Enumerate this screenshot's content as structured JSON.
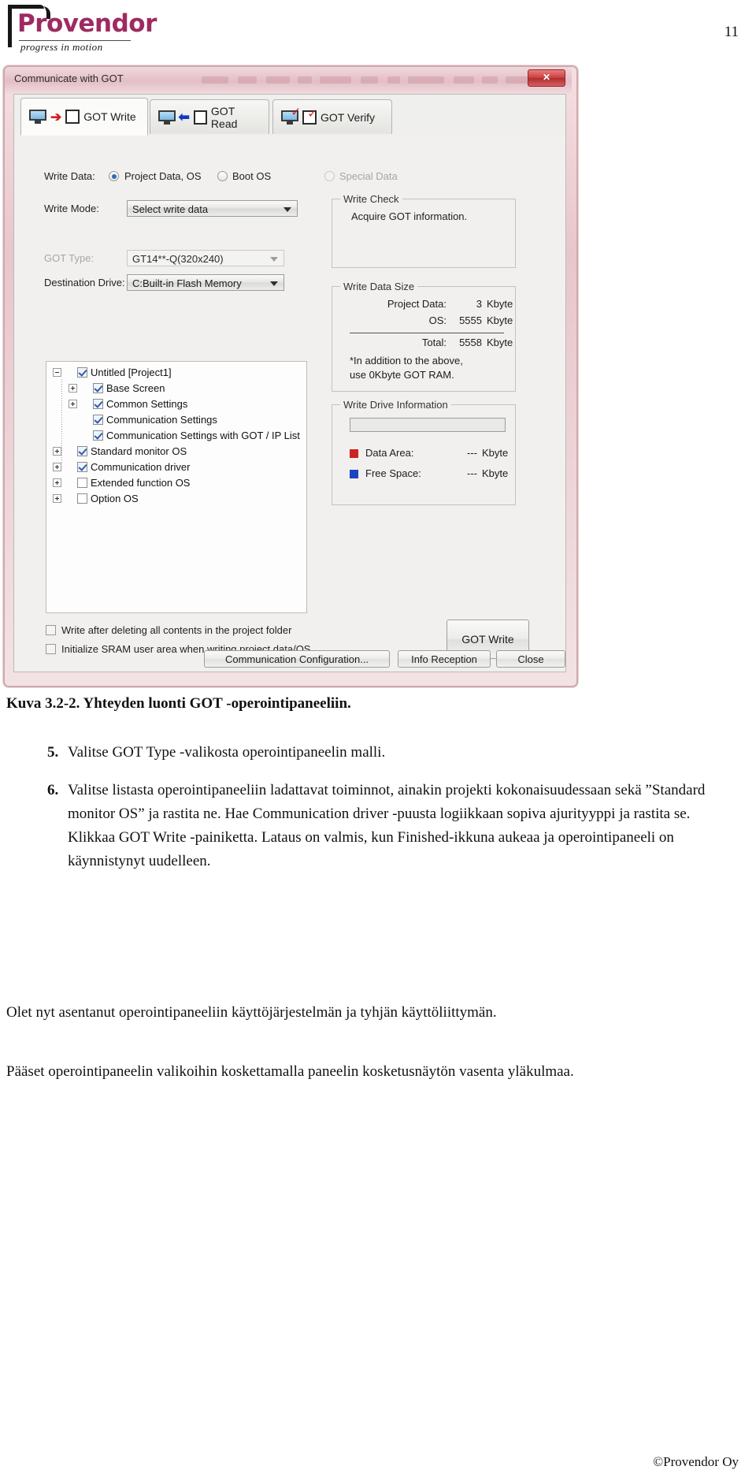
{
  "header": {
    "logo_name": "Provendor",
    "logo_tagline": "progress in motion",
    "page_number": "11"
  },
  "screenshot": {
    "window": {
      "title": "Communicate with GOT",
      "close_label": "✕"
    },
    "tabs": [
      {
        "label": "GOT Write",
        "icon": "monitor-write-icon",
        "active": true
      },
      {
        "label": "GOT Read",
        "icon": "monitor-read-icon",
        "active": false
      },
      {
        "label": "GOT Verify",
        "icon": "monitor-verify-icon",
        "active": false
      }
    ],
    "write_data": {
      "label": "Write Data:",
      "options": [
        {
          "label": "Project Data, OS",
          "selected": true,
          "disabled": false
        },
        {
          "label": "Boot OS",
          "selected": false,
          "disabled": false
        },
        {
          "label": "Special Data",
          "selected": false,
          "disabled": true
        }
      ]
    },
    "write_mode": {
      "label": "Write Mode:",
      "value": "Select write data"
    },
    "got_type": {
      "label": "GOT Type:",
      "value": "GT14**-Q(320x240)"
    },
    "destination_drive": {
      "label": "Destination Drive:",
      "value": "C:Built-in Flash Memory"
    },
    "tree": {
      "nodes": [
        {
          "label": "Untitled [Project1]",
          "checked": true,
          "expander": "minus",
          "level": 0
        },
        {
          "label": "Base Screen",
          "checked": true,
          "expander": "plus",
          "level": 1
        },
        {
          "label": "Common Settings",
          "checked": true,
          "expander": "plus",
          "level": 1
        },
        {
          "label": "Communication Settings",
          "checked": true,
          "expander": "none",
          "level": 1
        },
        {
          "label": "Communication Settings with GOT / IP List",
          "checked": true,
          "expander": "none",
          "level": 1
        },
        {
          "label": "Standard monitor OS",
          "checked": true,
          "expander": "plus",
          "level": 0
        },
        {
          "label": "Communication driver",
          "checked": true,
          "expander": "plus",
          "level": 0
        },
        {
          "label": "Extended function OS",
          "checked": false,
          "expander": "plus",
          "level": 0
        },
        {
          "label": "Option OS",
          "checked": false,
          "expander": "plus",
          "level": 0
        }
      ]
    },
    "write_check": {
      "title": "Write Check",
      "text": "Acquire GOT information."
    },
    "write_data_size": {
      "title": "Write Data Size",
      "rows": [
        {
          "label": "Project Data:",
          "value": "3",
          "unit": "Kbyte"
        },
        {
          "label": "OS:",
          "value": "5555",
          "unit": "Kbyte"
        },
        {
          "label": "Total:",
          "value": "5558",
          "unit": "Kbyte"
        }
      ],
      "note_line1": "*In addition to the above,",
      "note_line2": "use 0Kbyte GOT RAM."
    },
    "write_drive_information": {
      "title": "Write Drive Information",
      "rows": [
        {
          "label": "Data Area:",
          "value": "---",
          "unit": "Kbyte",
          "color": "#cc2222"
        },
        {
          "label": "Free Space:",
          "value": "---",
          "unit": "Kbyte",
          "color": "#1b43c0"
        }
      ]
    },
    "bottom_checks": [
      {
        "label": "Write after deleting all contents in the project folder",
        "checked": false
      },
      {
        "label": "Initialize SRAM user area when writing project data/OS",
        "checked": false
      }
    ],
    "buttons": {
      "got_write": "GOT Write",
      "communication_configuration": "Communication Configuration...",
      "info_reception": "Info Reception",
      "close": "Close"
    }
  },
  "caption": "Kuva 3.2-2. Yhteyden luonti GOT -operointipaneeliin.",
  "steps": [
    {
      "num": "5.",
      "text": "Valitse GOT Type -valikosta operointipaneelin malli."
    },
    {
      "num": "6.",
      "text": "Valitse listasta operointipaneeliin ladattavat toiminnot, ainakin projekti kokonaisuudessaan sekä ”Standard monitor OS” ja rastita ne. Hae Communication driver -puusta logiikkaan sopiva ajurityyppi ja rastita se. Klikkaa GOT Write -painiketta. Lataus on valmis, kun Finished-ikkuna aukeaa ja operointipaneeli on käynnistynyt uudelleen."
    }
  ],
  "paragraphs": [
    "Olet nyt asentanut operointipaneeliin käyttöjärjestelmän ja tyhjän käyttöliittymän.",
    "Pääset operointipaneelin valikoihin koskettamalla paneelin kosketusnäytön vasenta yläkulmaa."
  ],
  "footer": "©Provendor Oy"
}
